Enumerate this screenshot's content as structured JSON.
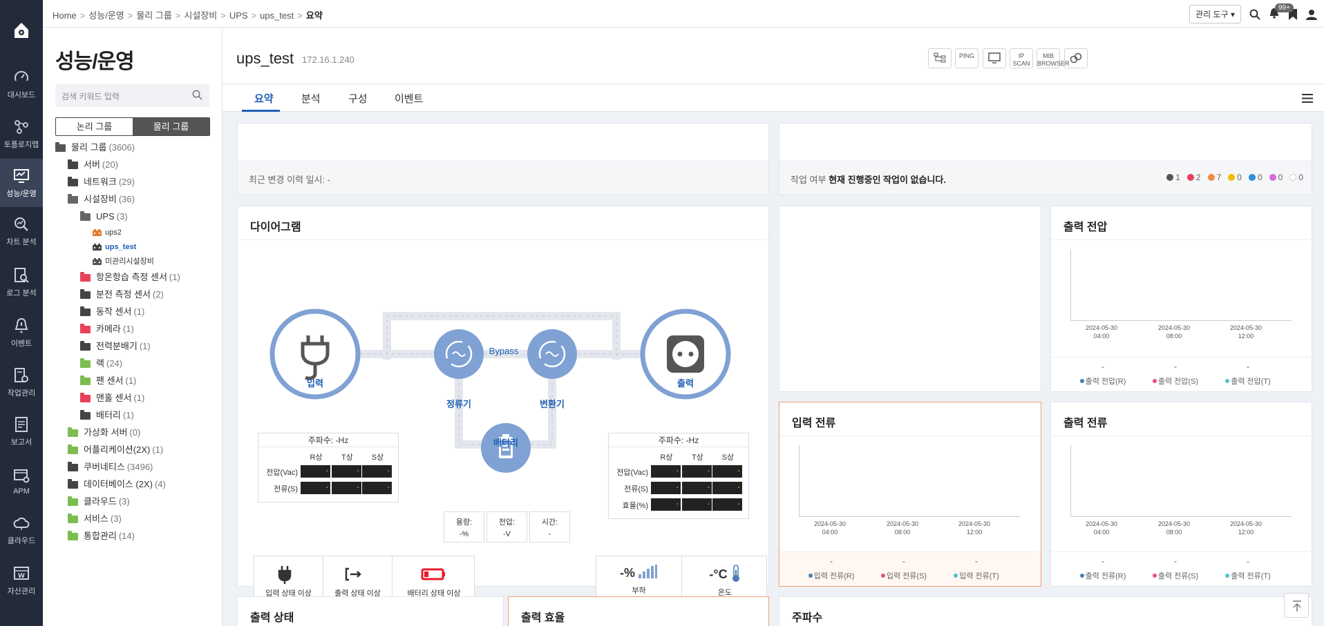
{
  "rail": {
    "items": [
      {
        "label": "대시보드",
        "icon": "gauge-icon"
      },
      {
        "label": "토폴로지맵",
        "icon": "topology-icon"
      },
      {
        "label": "성능/운영",
        "icon": "monitor-icon"
      },
      {
        "label": "차트 분석",
        "icon": "chart-search-icon"
      },
      {
        "label": "로그 분석",
        "icon": "log-search-icon"
      },
      {
        "label": "이벤트",
        "icon": "bell-alert-icon"
      },
      {
        "label": "작업관리",
        "icon": "task-icon"
      },
      {
        "label": "보고서",
        "icon": "report-icon"
      },
      {
        "label": "APM",
        "icon": "apm-icon"
      },
      {
        "label": "클라우드",
        "icon": "cloud-icon"
      },
      {
        "label": "자산관리",
        "icon": "asset-icon"
      }
    ]
  },
  "breadcrumb": [
    "Home",
    "성능/운영",
    "물리 그룹",
    "시설장비",
    "UPS",
    "ups_test",
    "요약"
  ],
  "topbar": {
    "tools_label": "관리 도구",
    "notif_count": "99+"
  },
  "sidebar": {
    "title": "성능/운영",
    "search_placeholder": "검색 키워드 입력",
    "seg": [
      "논리 그룹",
      "물리 그룹"
    ],
    "tree": [
      {
        "label": "물리 그룹",
        "count": "(3606)",
        "color": "#555",
        "open": true
      },
      {
        "label": "서버",
        "count": "(20)",
        "color": "#444"
      },
      {
        "label": "네트워크",
        "count": "(29)",
        "color": "#444"
      },
      {
        "label": "시설장비",
        "count": "(36)",
        "color": "#666",
        "open": true
      },
      {
        "label": "UPS",
        "count": "(3)",
        "color": "#666",
        "open": true
      },
      {
        "label": "ups2",
        "count": "",
        "color": "#e07a2c"
      },
      {
        "label": "ups_test",
        "count": "",
        "color": "#444"
      },
      {
        "label": "미관리시설장비",
        "count": "",
        "color": "#555"
      },
      {
        "label": "항온항습 측정 센서",
        "count": "(1)",
        "color": "#e8415a"
      },
      {
        "label": "분전 측정 센서",
        "count": "(2)",
        "color": "#444"
      },
      {
        "label": "동작 센서",
        "count": "(1)",
        "color": "#444"
      },
      {
        "label": "카메라",
        "count": "(1)",
        "color": "#e8415a"
      },
      {
        "label": "전력분배기",
        "count": "(1)",
        "color": "#444"
      },
      {
        "label": "랙",
        "count": "(24)",
        "color": "#7dbd4f"
      },
      {
        "label": "팬 센서",
        "count": "(1)",
        "color": "#7dbd4f"
      },
      {
        "label": "맨홀 센서",
        "count": "(1)",
        "color": "#e8415a"
      },
      {
        "label": "배터리",
        "count": "(1)",
        "color": "#444"
      },
      {
        "label": "가상화 서버",
        "count": "(0)",
        "color": "#7dbd4f"
      },
      {
        "label": "어플리케이션(2X)",
        "count": "(1)",
        "color": "#7dbd4f"
      },
      {
        "label": "쿠버네티스",
        "count": "(3496)",
        "color": "#444"
      },
      {
        "label": "데이터베이스 (2X)",
        "count": "(4)",
        "color": "#444"
      },
      {
        "label": "클라우드",
        "count": "(3)",
        "color": "#7dbd4f"
      },
      {
        "label": "서비스",
        "count": "(3)",
        "color": "#7dbd4f"
      },
      {
        "label": "통합관리",
        "count": "(14)",
        "color": "#7dbd4f"
      }
    ]
  },
  "device": {
    "name": "ups_test",
    "ip": "172.16.1.240",
    "icon_buttons": [
      {
        "icon": "topology-small-icon",
        "text": ""
      },
      {
        "icon": "ping-icon",
        "text": "PING"
      },
      {
        "icon": "monitor-small-icon",
        "text": ""
      },
      {
        "icon": "ipscan-icon",
        "text": "IP SCAN"
      },
      {
        "icon": "mib-icon",
        "text": "MIB BROWSER"
      },
      {
        "icon": "link-icon",
        "text": ""
      }
    ]
  },
  "tabs": [
    "요약",
    "분석",
    "구성",
    "이벤트"
  ],
  "info": {
    "last_change": "최근 변경 이력 일시: -",
    "job_label": "작업 여부",
    "job_status": "현재 진행중인 작업이 없습니다.",
    "legend": [
      {
        "color": "#555",
        "n": "1"
      },
      {
        "color": "#e8415a",
        "n": "2"
      },
      {
        "color": "#f08a3c",
        "n": "7"
      },
      {
        "color": "#f5b800",
        "n": "0"
      },
      {
        "color": "#2f8fd8",
        "n": "0"
      },
      {
        "color": "#d86bd8",
        "n": "0"
      },
      {
        "color": "#ffffff",
        "n": "0"
      }
    ]
  },
  "diagram": {
    "title": "다이어그램",
    "bypass": "Bypass",
    "input": "입력",
    "rectifier": "정류기",
    "inverter": "변환기",
    "output": "출력",
    "battery": "배터리",
    "in_table": {
      "freq": "주파수: -Hz",
      "phases": [
        "R상",
        "T상",
        "S상"
      ],
      "rows": [
        {
          "label": "전압(Vac)",
          "vals": [
            "-",
            "-",
            "-"
          ]
        },
        {
          "label": "전류(S)",
          "vals": [
            "-",
            "-",
            "-"
          ]
        }
      ]
    },
    "out_table": {
      "freq": "주파수: -Hz",
      "phases": [
        "R상",
        "T상",
        "S상"
      ],
      "rows": [
        {
          "label": "전압(Vac)",
          "vals": [
            "-",
            "-",
            "-"
          ]
        },
        {
          "label": "전류(S)",
          "vals": [
            "-",
            "-",
            "-"
          ]
        },
        {
          "label": "효율(%)",
          "vals": [
            "-",
            "-",
            "-"
          ]
        }
      ]
    },
    "battery_stats": [
      {
        "label": "용량:",
        "value": "-%"
      },
      {
        "label": "전압:",
        "value": "-V"
      },
      {
        "label": "시간:",
        "value": "-"
      }
    ],
    "status": [
      {
        "label": "입력 상태 이상",
        "icon": "plug-icon"
      },
      {
        "label": "출력 상태 이상",
        "icon": "exit-icon"
      },
      {
        "label": "배터리 상태 이상",
        "icon": "battery-alert-icon"
      }
    ],
    "load": {
      "value": "-%",
      "label": "부하"
    },
    "temp": {
      "value": "-°C",
      "label": "온도"
    }
  },
  "charts": {
    "times": [
      "2024-05-30\n04:00",
      "2024-05-30\n08:00",
      "2024-05-30\n12:00"
    ],
    "out_voltage": {
      "title": "출력 전압",
      "values": [
        "-",
        "-",
        "-"
      ],
      "legend": [
        "출력 전압(R)",
        "출력 전압(S)",
        "출력 전압(T)"
      ]
    },
    "in_current": {
      "title": "입력 전류",
      "values": [
        "-",
        "-",
        "-"
      ],
      "legend": [
        "입력 전류(R)",
        "입력 전류(S)",
        "입력 전류(T)"
      ]
    },
    "out_current": {
      "title": "출력 전류",
      "values": [
        "-",
        "-",
        "-"
      ],
      "legend": [
        "출력 전류(R)",
        "출력 전류(S)",
        "출력 전류(T)"
      ]
    },
    "legend_colors": [
      "#4a7fb5",
      "#e8507a",
      "#4bc3c9"
    ]
  },
  "bottom": {
    "out_state": "출력 상태",
    "out_eff": "출력 효율",
    "freq": "주파수"
  }
}
